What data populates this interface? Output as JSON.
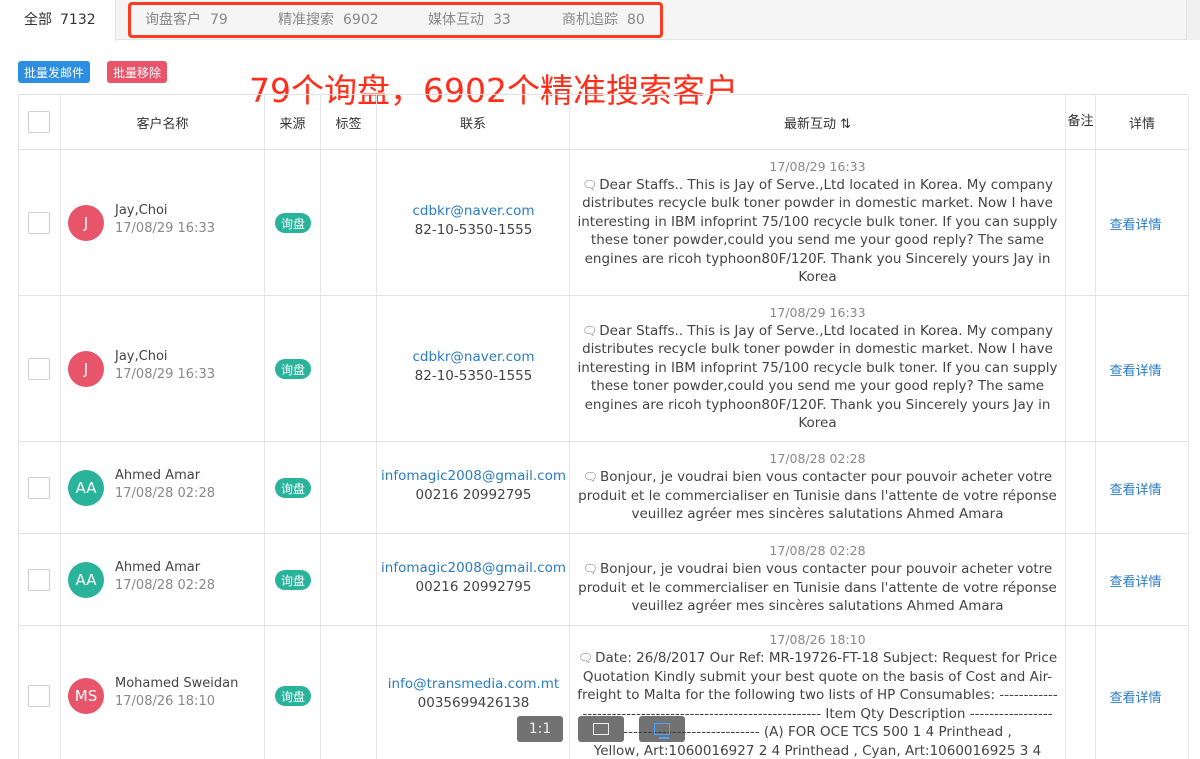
{
  "tabs": {
    "all": {
      "label": "全部",
      "count": "7132"
    },
    "items": [
      {
        "label": "询盘客户",
        "count": "79"
      },
      {
        "label": "精准搜索",
        "count": "6902"
      },
      {
        "label": "媒体互动",
        "count": "33"
      },
      {
        "label": "商机追踪",
        "count": "80"
      }
    ]
  },
  "toolbar": {
    "bulk_email": "批量发邮件",
    "bulk_remove": "批量移除"
  },
  "annotation": "79个询盘，6902个精准搜索客户",
  "table": {
    "headers": {
      "customer": "客户名称",
      "source": "来源",
      "tags": "标签",
      "contact": "联系",
      "latest": "最新互动 ⇅",
      "note": "备注",
      "detail": "详情"
    },
    "rows": [
      {
        "avatar": "J",
        "avatar_color": "#e8546a",
        "name": "Jay,Choi",
        "date": "17/08/29 16:33",
        "source": "询盘",
        "email": "cdbkr@naver.com",
        "phone": "82-10-5350-1555",
        "time": "17/08/29 16:33",
        "lines": [
          "Dear Staffs.. This is Jay of Serve.,Ltd located in Korea. My company",
          "distributes recycle bulk toner powder in domestic market. Now I have",
          "interesting in IBM infoprint 75/100 recycle bulk toner. If you can supply",
          "these toner powder,could you send me your good reply? The same",
          "engines are ricoh typhoon80F/120F. Thank you Sincerely yours Jay in",
          "Korea"
        ],
        "detail": "查看详情"
      },
      {
        "avatar": "J",
        "avatar_color": "#e8546a",
        "name": "Jay,Choi",
        "date": "17/08/29 16:33",
        "source": "询盘",
        "email": "cdbkr@naver.com",
        "phone": "82-10-5350-1555",
        "time": "17/08/29 16:33",
        "lines": [
          "Dear Staffs.. This is Jay of Serve.,Ltd located in Korea. My company",
          "distributes recycle bulk toner powder in domestic market. Now I have",
          "interesting in IBM infoprint 75/100 recycle bulk toner. If you can supply",
          "these toner powder,could you send me your good reply? The same",
          "engines are ricoh typhoon80F/120F. Thank you Sincerely yours Jay in",
          "Korea"
        ],
        "detail": "查看详情"
      },
      {
        "avatar": "AA",
        "avatar_color": "#2ab39b",
        "name": "Ahmed Amar",
        "date": "17/08/28 02:28",
        "source": "询盘",
        "email": "infomagic2008@gmail.com",
        "phone": "00216 20992795",
        "time": "17/08/28 02:28",
        "lines": [
          "Bonjour, je voudrai bien vous contacter pour pouvoir acheter votre",
          "produit et le commercialiser en Tunisie dans l'attente de votre réponse",
          "veuillez agréer mes sincères salutations Ahmed Amara"
        ],
        "detail": "查看详情"
      },
      {
        "avatar": "AA",
        "avatar_color": "#2ab39b",
        "name": "Ahmed Amar",
        "date": "17/08/28 02:28",
        "source": "询盘",
        "email": "infomagic2008@gmail.com",
        "phone": "00216 20992795",
        "time": "17/08/28 02:28",
        "lines": [
          "Bonjour, je voudrai bien vous contacter pour pouvoir acheter votre",
          "produit et le commercialiser en Tunisie dans l'attente de votre réponse",
          "veuillez agréer mes sincères salutations Ahmed Amara"
        ],
        "detail": "查看详情"
      },
      {
        "avatar": "MS",
        "avatar_color": "#e8546a",
        "name": "Mohamed Sweidan",
        "date": "17/08/26 18:10",
        "source": "询盘",
        "email": "info@transmedia.com.mt",
        "phone": "0035699426138",
        "time": "17/08/26 18:10",
        "lines": [
          "Date: 26/8/2017 Our Ref: MR-19726-FT-18 Subject: Request for Price",
          "Quotation Kindly submit your best quote on the basis of Cost and Air-",
          "freight to Malta for the following two lists of HP Consumables: ------------",
          "------------------------------------------------- Item Qty Description -----------------",
          "---------------------------- (A) FOR OCE TCS 500 1 4 Printhead ,",
          "Yellow, Art:1060016927 2 4 Printhead , Cyan, Art:1060016925 3 4"
        ],
        "detail": "查看详情"
      }
    ]
  },
  "viewer": {
    "zoom_label": "1:1",
    "fit_icon": "fit-screen-icon",
    "window_icon": "fit-window-icon"
  }
}
